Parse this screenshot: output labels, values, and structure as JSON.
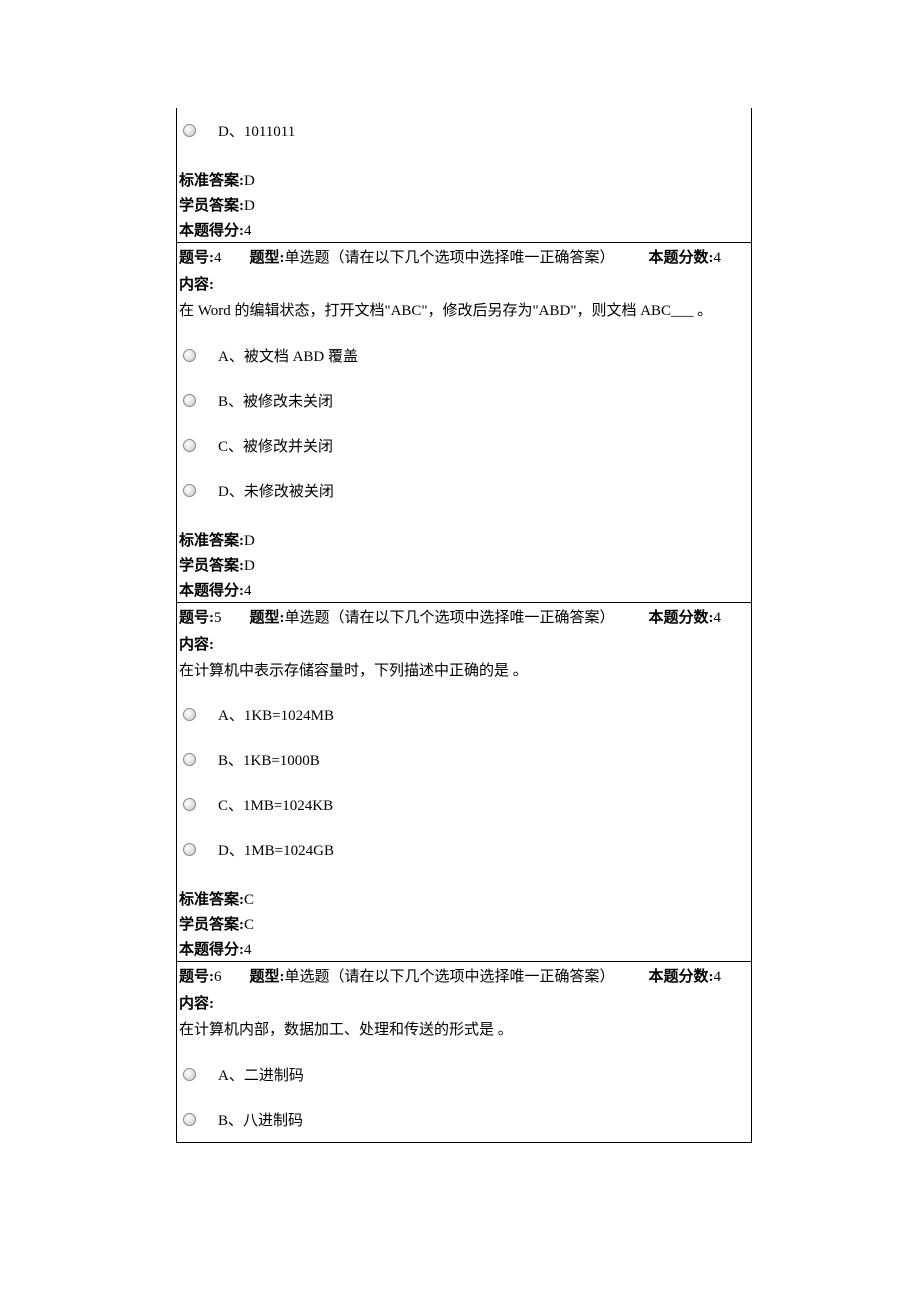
{
  "labels": {
    "standard_answer": "标准答案:",
    "student_answer": "学员答案:",
    "score": "本题得分:",
    "question_no": "题号:",
    "question_type": "题型:",
    "question_type_value": "单选题（请在以下几个选项中选择唯一正确答案）",
    "full_score": "本题分数:",
    "content": "内容:"
  },
  "partial": {
    "option_d": "D、1011011",
    "standard_answer": "D",
    "student_answer": "D",
    "score": "4"
  },
  "q4": {
    "number": "4",
    "full_score": "4",
    "question": "在 Word 的编辑状态，打开文档\"ABC\"，修改后另存为\"ABD\"，则文档 ABC___ 。",
    "options": {
      "a": "A、被文档 ABD 覆盖",
      "b": "B、被修改未关闭",
      "c": "C、被修改并关闭",
      "d": "D、未修改被关闭"
    },
    "standard_answer": "D",
    "student_answer": "D",
    "score": "4"
  },
  "q5": {
    "number": "5",
    "full_score": "4",
    "question": "在计算机中表示存储容量时，下列描述中正确的是 。",
    "options": {
      "a": "A、1KB=1024MB",
      "b": "B、1KB=1000B",
      "c": "C、1MB=1024KB",
      "d": "D、1MB=1024GB"
    },
    "standard_answer": "C",
    "student_answer": "C",
    "score": "4"
  },
  "q6": {
    "number": "6",
    "full_score": "4",
    "question": "在计算机内部，数据加工、处理和传送的形式是 。",
    "options": {
      "a": "A、二进制码",
      "b": "B、八进制码"
    }
  }
}
